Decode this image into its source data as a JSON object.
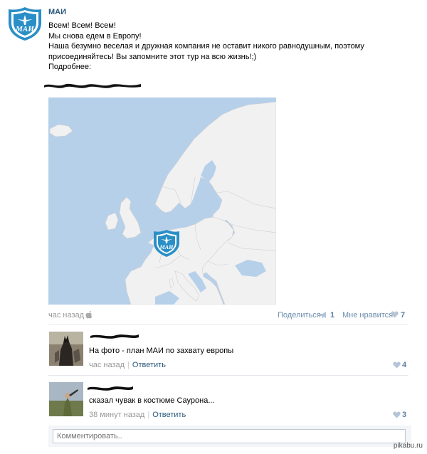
{
  "post": {
    "author": "МАИ",
    "logo_text": "МАИ",
    "lines": [
      "Всем! Всем! Всем!",
      "Мы снова едем в Европу!",
      "Наша безумно веселая и дружная компания не оставит никого равнодушным, поэтому",
      "присоединяйтесь! Вы запомните этот тур на всю жизнь!;)",
      "Подробнее:"
    ],
    "time": "час назад",
    "share_label": "Поделиться",
    "share_count": "1",
    "like_label": "Мне нравится",
    "like_count": "7"
  },
  "comments": [
    {
      "text": "На фото - план МАИ по захвату европы",
      "time": "час назад",
      "reply": "Ответить",
      "likes": "4"
    },
    {
      "text": "сказал чувак в костюме Саурона...",
      "time": "38 минут назад",
      "reply": "Ответить",
      "likes": "3"
    }
  ],
  "comment_input": {
    "placeholder": "Комментировать.."
  },
  "watermark": "pikabu.ru",
  "colors": {
    "link": "#2b587a",
    "logo": "#2a8fc7",
    "meta": "#999999"
  },
  "icons": [
    "apple-icon",
    "megaphone-icon",
    "heart-icon"
  ]
}
